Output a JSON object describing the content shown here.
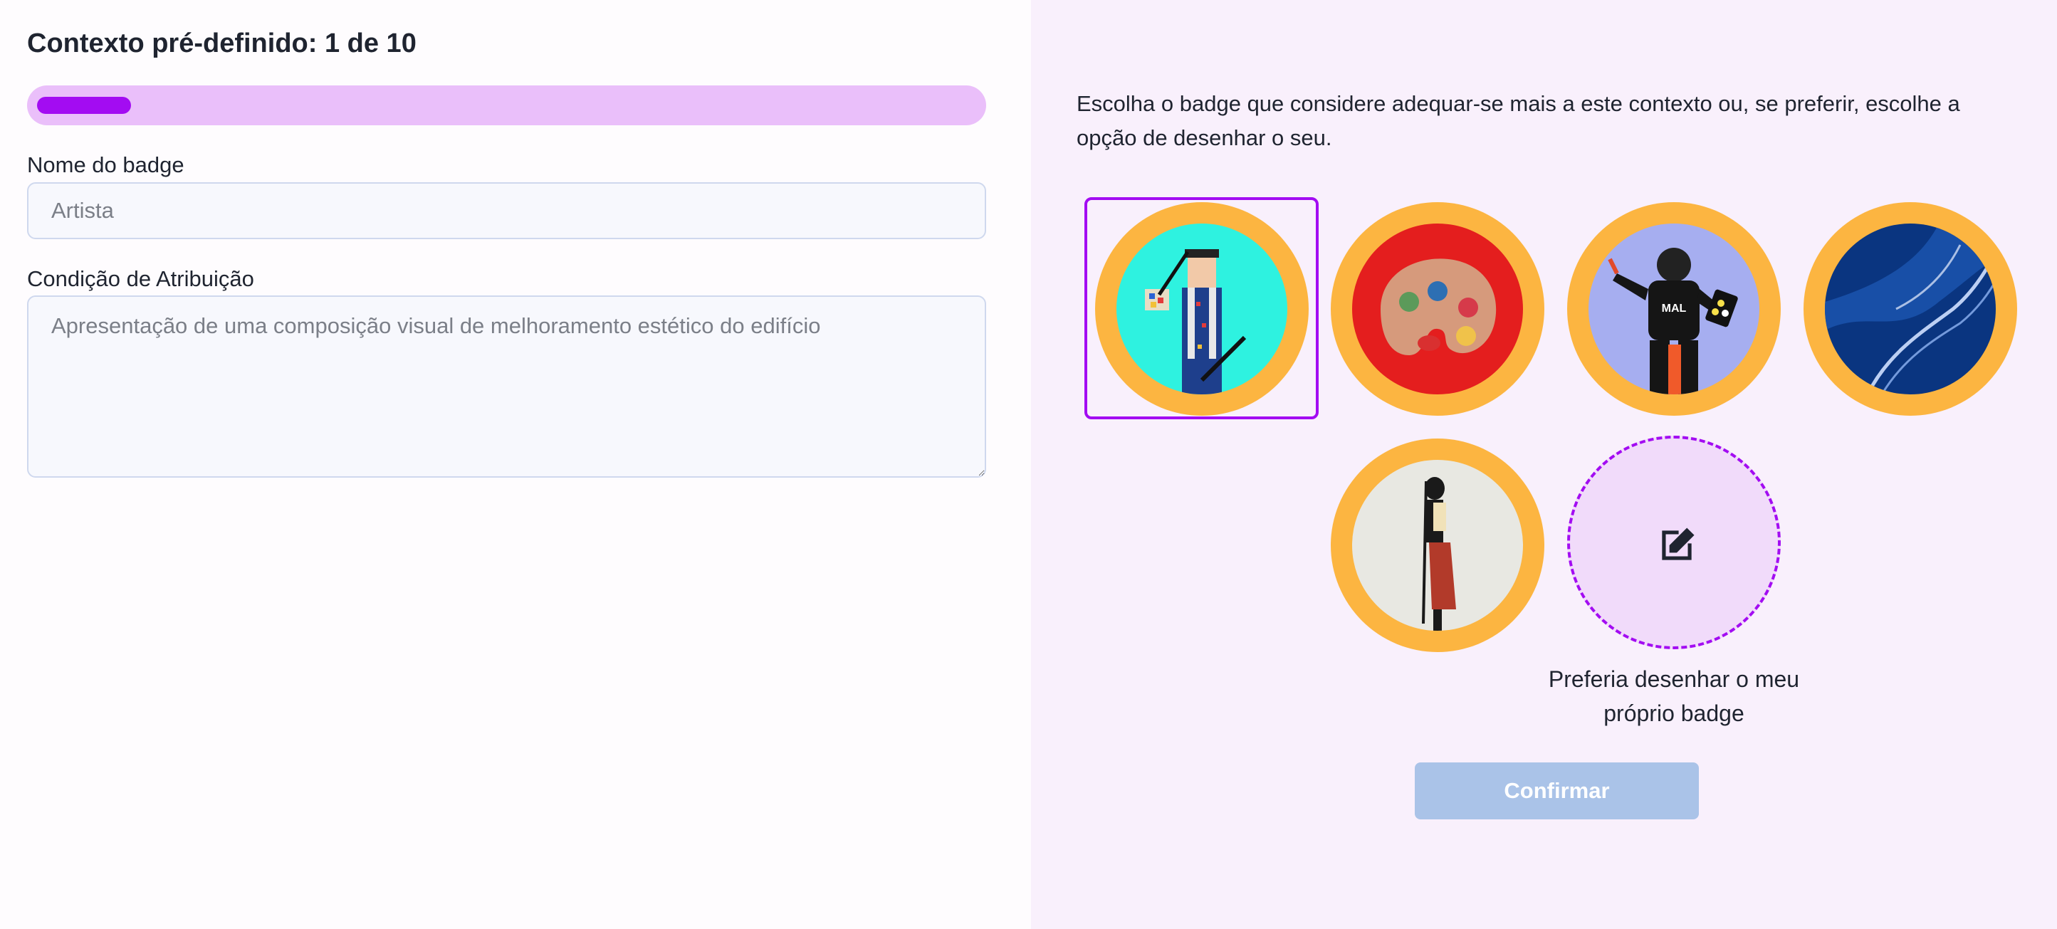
{
  "form": {
    "title": "Contexto pré-definido: 1 de 10",
    "progress_fraction": 0.1,
    "name_label": "Nome do badge",
    "name_placeholder": "Artista",
    "condition_label": "Condição de Atribuição",
    "condition_placeholder": "Apresentação de uma composição visual de melhoramento estético do edifício"
  },
  "chooser": {
    "instructions": "Escolha o badge que considere adequar-se mais a este contexto ou, se preferir, escolhe a opção de desenhar o seu.",
    "badges": [
      {
        "subject": "pixel-art painter with brush and palette",
        "selected": true
      },
      {
        "subject": "paint palette",
        "selected": false
      },
      {
        "subject": "hooded artist with palette and brush",
        "selected": false
      },
      {
        "subject": "abstract blue waves",
        "selected": false
      },
      {
        "subject": "figure holding a long brush",
        "selected": false
      }
    ],
    "draw_own_label": "Preferia desenhar o meu próprio badge",
    "confirm_label": "Confirmar"
  },
  "colors": {
    "accent": "#a30cf2",
    "progress_track": "#eabffa",
    "badge_ring": "#fcb541",
    "confirm_disabled": "#aac3e8",
    "right_panel_bg": "#f9f0fc"
  }
}
